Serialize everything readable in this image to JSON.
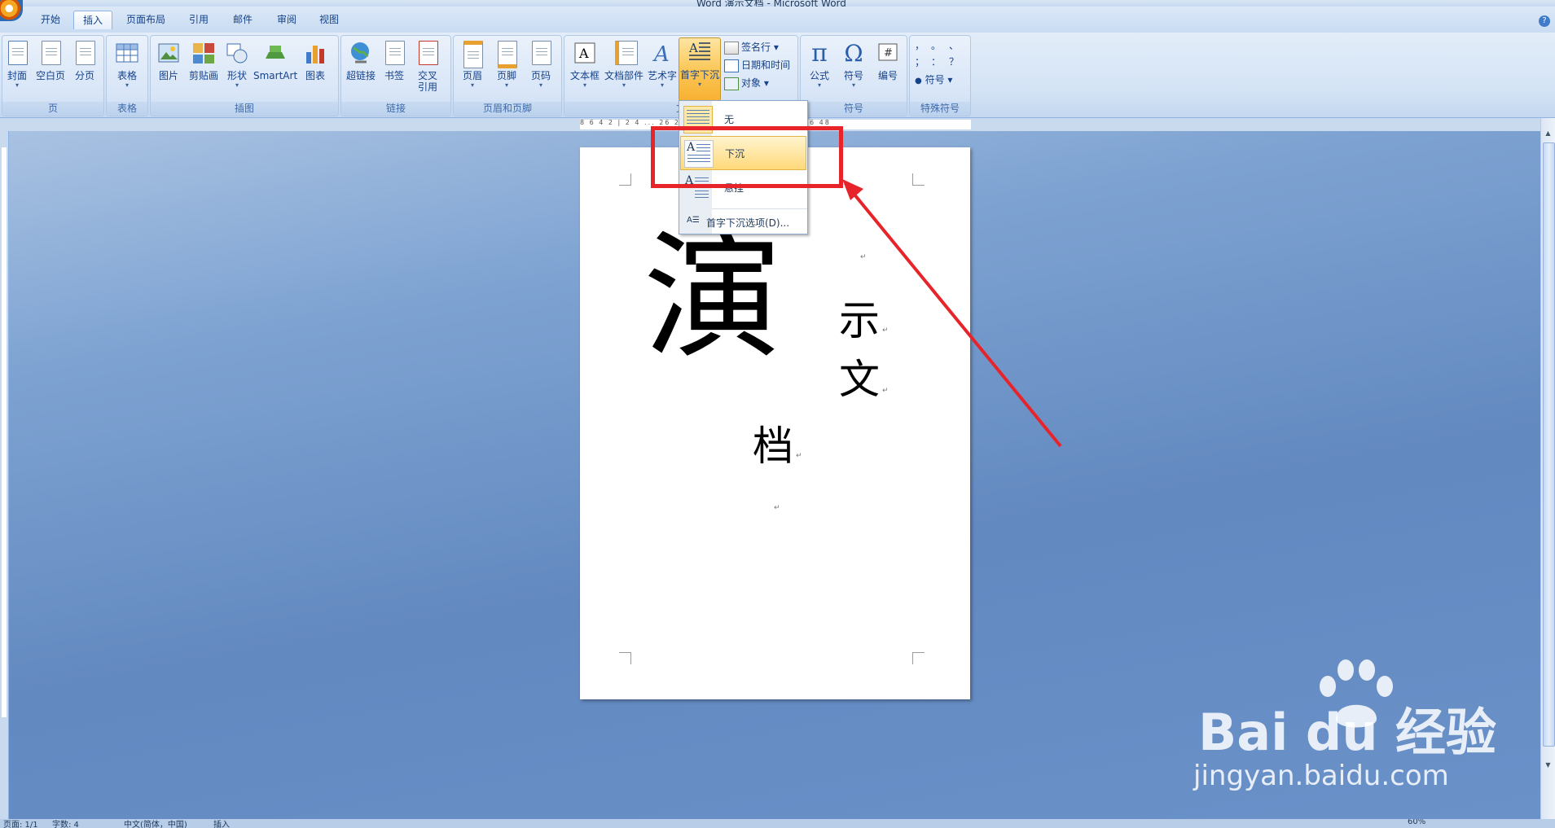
{
  "window": {
    "title": "Word 演示文档 - Microsoft Word"
  },
  "tabs": [
    {
      "label": "开始",
      "active": false
    },
    {
      "label": "插入",
      "active": true
    },
    {
      "label": "页面布局",
      "active": false
    },
    {
      "label": "引用",
      "active": false
    },
    {
      "label": "邮件",
      "active": false
    },
    {
      "label": "审阅",
      "active": false
    },
    {
      "label": "视图",
      "active": false
    }
  ],
  "ribbon": {
    "groups": {
      "pages": {
        "label": "页",
        "buttons": [
          "封面",
          "空白页",
          "分页"
        ]
      },
      "tables": {
        "label": "表格",
        "buttons": [
          "表格"
        ]
      },
      "illustrations": {
        "label": "插图",
        "buttons": [
          "图片",
          "剪贴画",
          "形状",
          "SmartArt",
          "图表"
        ]
      },
      "links": {
        "label": "链接",
        "buttons": [
          "超链接",
          "书签",
          "交叉引用"
        ]
      },
      "header_footer": {
        "label": "页眉和页脚",
        "buttons": [
          "页眉",
          "页脚",
          "页码"
        ]
      },
      "text": {
        "label": "文",
        "buttons": [
          "文本框",
          "文档部件",
          "艺术字",
          "首字下沉"
        ],
        "small": [
          "签名行",
          "日期和时间",
          "对象"
        ]
      },
      "symbols": {
        "label": "符号",
        "buttons": [
          "公式",
          "符号",
          "编号"
        ]
      },
      "special": {
        "label": "特殊符号",
        "chars": [
          "，",
          "。",
          "、",
          "；",
          "：",
          "？"
        ],
        "symbol_button": "符号"
      }
    }
  },
  "ruler": {
    "numbers": "8 6 4 2 | 2 4 ... 26 28 30 32 34 36 38 | 42 44 46 48"
  },
  "dropdown": {
    "items": [
      {
        "label": "无",
        "selected": true
      },
      {
        "label": "下沉",
        "highlighted": true
      },
      {
        "label": "悬挂",
        "highlighted": false
      }
    ],
    "options_label": "首字下沉选项(D)..."
  },
  "document": {
    "dropcap": "演",
    "chars": [
      "示",
      "文",
      "档"
    ],
    "para_mark": "↵"
  },
  "statusbar": {
    "page": "页面: 1/1",
    "words": "字数: 4",
    "language": "中文(简体，中国)",
    "mode": "插入",
    "zoom": "60%"
  },
  "watermark": {
    "brand": "Bai du 经验",
    "url": "jingyan.baidu.com"
  },
  "colors": {
    "annotation": "#e8242b",
    "ribbon_bg": "#dbe8f7",
    "workspace": "#6c93c6"
  }
}
